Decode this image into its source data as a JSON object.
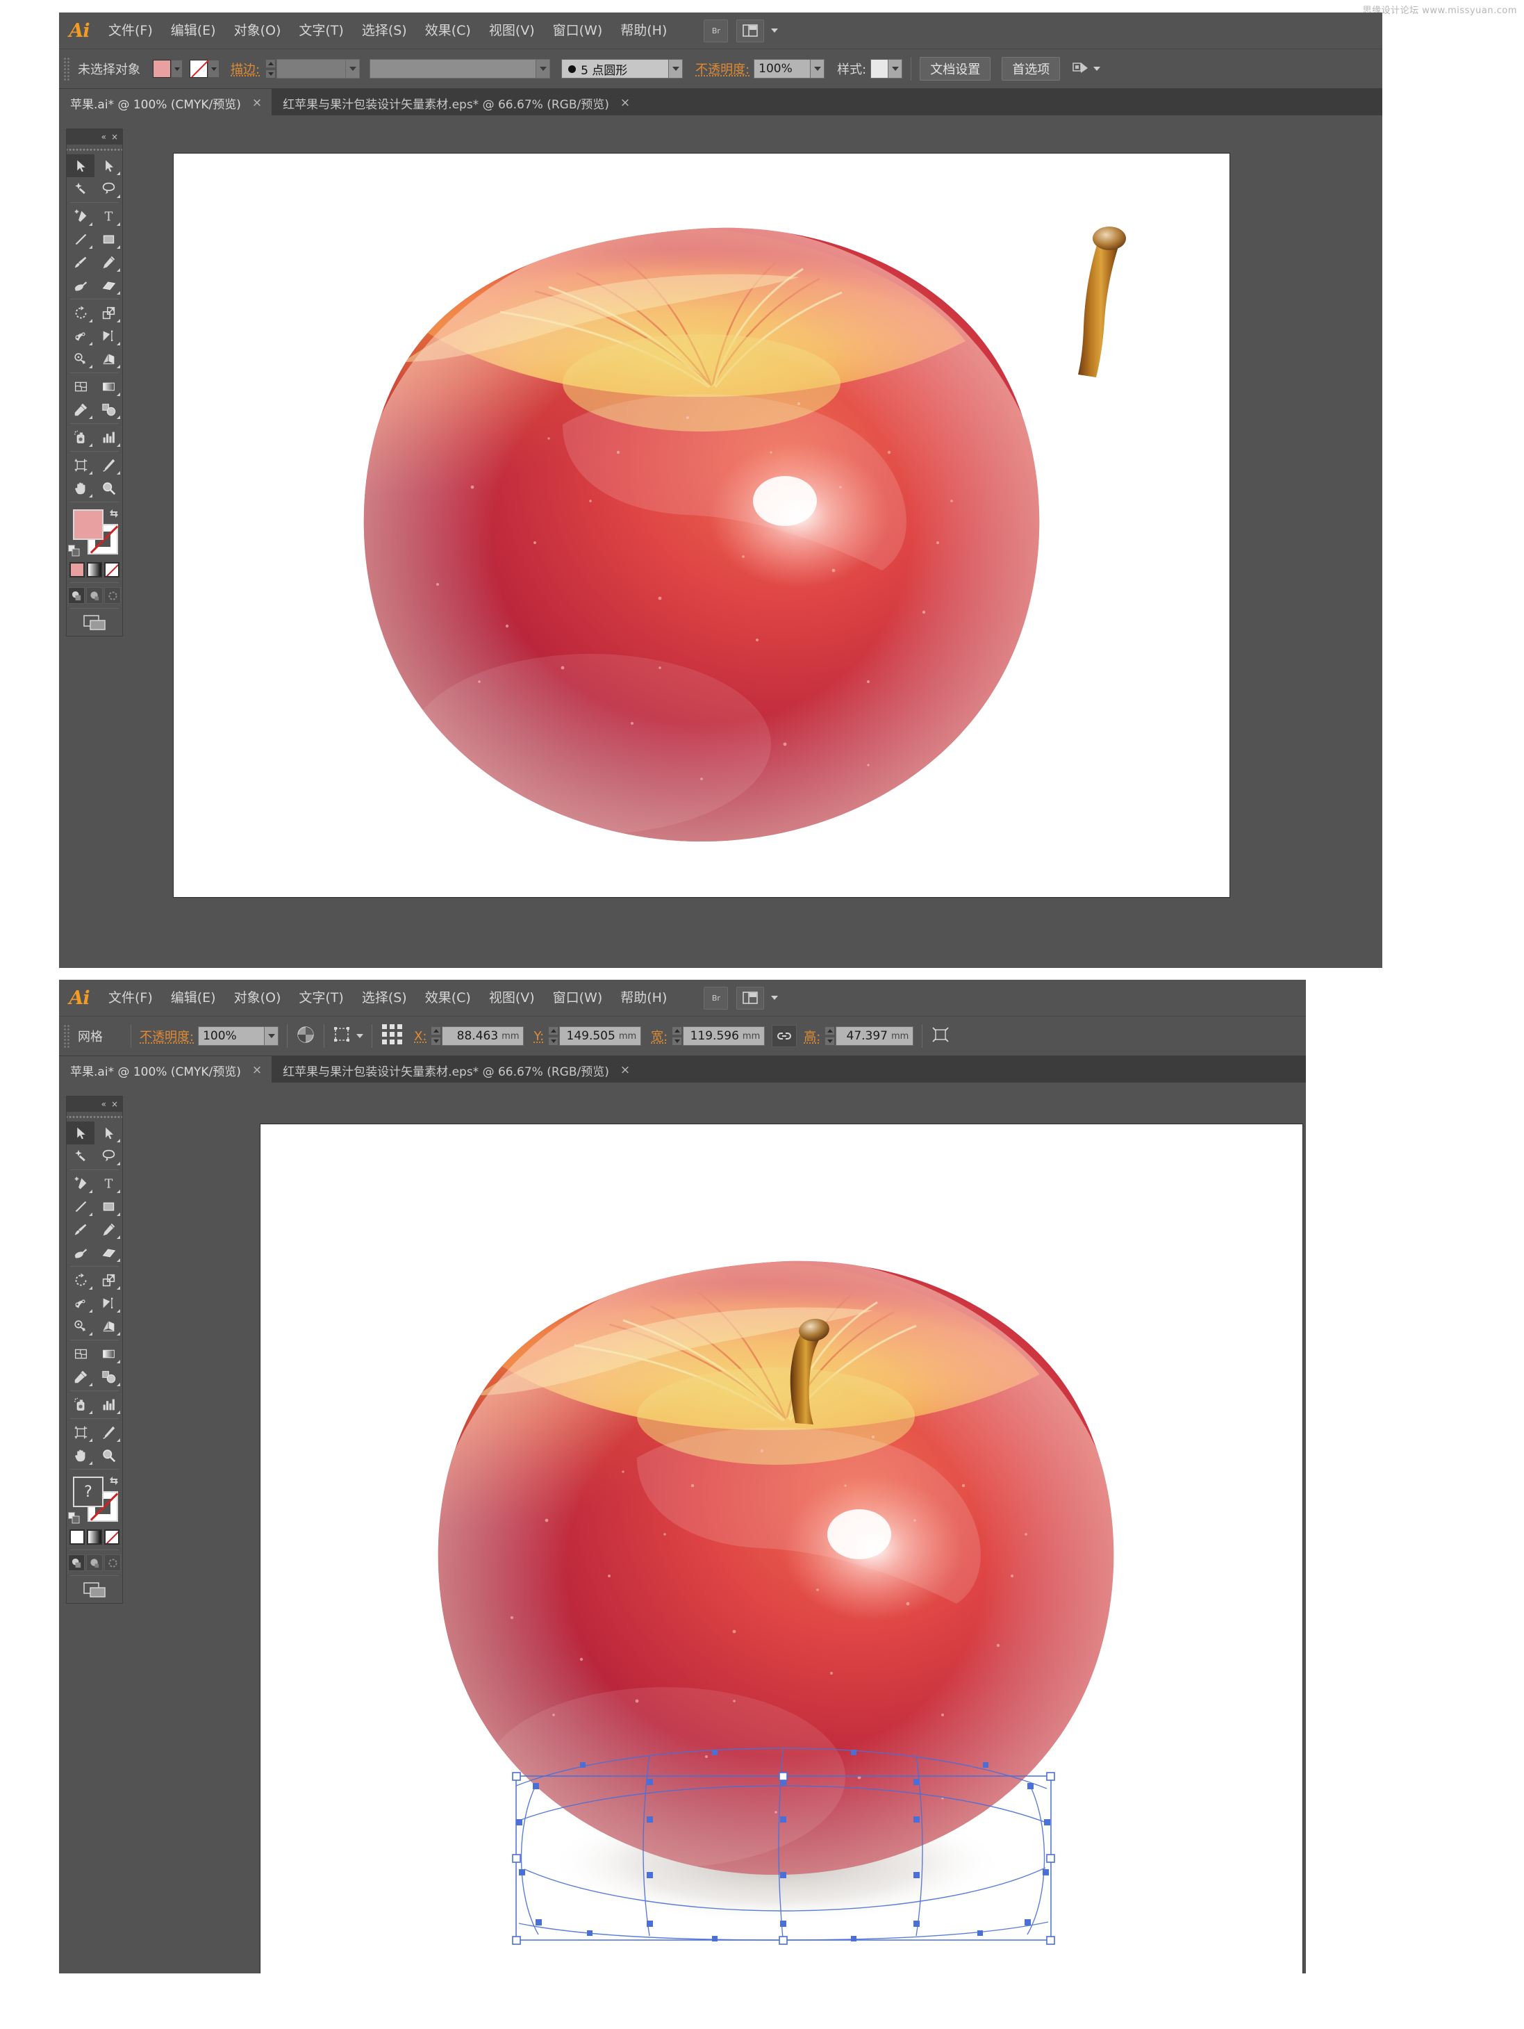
{
  "watermark": "思缘设计论坛  www.missyuan.com",
  "app": {
    "name": "Ai"
  },
  "menu": {
    "items": [
      {
        "label": "文件(F)"
      },
      {
        "label": "编辑(E)"
      },
      {
        "label": "对象(O)"
      },
      {
        "label": "文字(T)"
      },
      {
        "label": "选择(S)"
      },
      {
        "label": "效果(C)"
      },
      {
        "label": "视图(V)"
      },
      {
        "label": "窗口(W)"
      },
      {
        "label": "帮助(H)"
      }
    ],
    "bridge_label": "Br"
  },
  "window1": {
    "control_bar": {
      "selection_status": "未选择对象",
      "fill_color": "#e8a0a0",
      "stroke_label": "描边:",
      "stroke_weight": "",
      "stroke_profile": "",
      "brush_label": "5 点圆形",
      "opacity_label": "不透明度:",
      "opacity_value": "100%",
      "style_label": "样式:",
      "doc_setup_button": "文档设置",
      "preferences_button": "首选项"
    },
    "tabs": [
      {
        "title": "苹果.ai* @ 100% (CMYK/预览)",
        "active": true,
        "close": "×"
      },
      {
        "title": "红苹果与果汁包装设计矢量素材.eps* @ 66.67% (RGB/预览)",
        "active": false,
        "close": "×"
      }
    ],
    "toolbox": {
      "fill_swatch_color": "#e8a0a0",
      "fill_swatch_label": "",
      "collapse_icon": "«",
      "close_icon": "×"
    }
  },
  "window2": {
    "control_bar": {
      "object_type": "网格",
      "opacity_label": "不透明度:",
      "opacity_value": "100%",
      "x_label": "X:",
      "x_value": "88.463",
      "x_unit": "mm",
      "y_label": "Y:",
      "y_value": "149.505",
      "y_unit": "mm",
      "w_label": "宽:",
      "w_value": "119.596",
      "w_unit": "mm",
      "h_label": "高:",
      "h_value": "47.397",
      "h_unit": "mm"
    },
    "tabs": [
      {
        "title": "苹果.ai* @ 100% (CMYK/预览)",
        "active": true,
        "close": "×"
      },
      {
        "title": "红苹果与果汁包装设计矢量素材.eps* @ 66.67% (RGB/预览)",
        "active": false,
        "close": "×"
      }
    ],
    "toolbox": {
      "fill_swatch_color": "#535353",
      "fill_swatch_label": "?",
      "collapse_icon": "«",
      "close_icon": "×"
    }
  },
  "tools": [
    {
      "name": "selection-tool",
      "selected": true
    },
    {
      "name": "direct-selection-tool",
      "selected": false
    },
    {
      "name": "magic-wand-tool",
      "selected": false
    },
    {
      "name": "lasso-tool",
      "selected": false
    },
    {
      "name": "pen-tool",
      "selected": false
    },
    {
      "name": "type-tool",
      "selected": false
    },
    {
      "name": "line-segment-tool",
      "selected": false
    },
    {
      "name": "rectangle-tool",
      "selected": false
    },
    {
      "name": "paintbrush-tool",
      "selected": false
    },
    {
      "name": "pencil-tool",
      "selected": false
    },
    {
      "name": "blob-brush-tool",
      "selected": false
    },
    {
      "name": "eraser-tool",
      "selected": false
    },
    {
      "name": "rotate-tool",
      "selected": false
    },
    {
      "name": "scale-tool",
      "selected": false
    },
    {
      "name": "width-tool",
      "selected": false
    },
    {
      "name": "free-transform-tool",
      "selected": false
    },
    {
      "name": "shape-builder-tool",
      "selected": false
    },
    {
      "name": "perspective-grid-tool",
      "selected": false
    },
    {
      "name": "mesh-tool",
      "selected": false
    },
    {
      "name": "gradient-tool",
      "selected": false
    },
    {
      "name": "eyedropper-tool",
      "selected": false
    },
    {
      "name": "blend-tool",
      "selected": false
    },
    {
      "name": "symbol-sprayer-tool",
      "selected": false
    },
    {
      "name": "column-graph-tool",
      "selected": false
    },
    {
      "name": "artboard-tool",
      "selected": false
    },
    {
      "name": "slice-tool",
      "selected": false
    },
    {
      "name": "hand-tool",
      "selected": false
    },
    {
      "name": "zoom-tool",
      "selected": false
    }
  ],
  "artwork": {
    "apple_top_alt": "红苹果插画 - 茎已分离",
    "apple_bottom_alt": "红苹果插画 - 茎已附加，底部网格对象被选中"
  }
}
